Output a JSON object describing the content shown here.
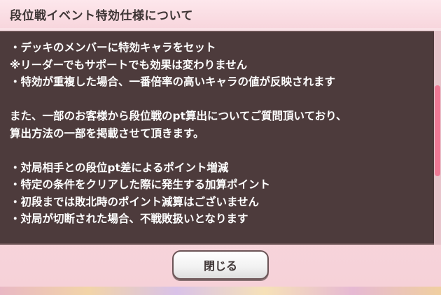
{
  "dialog": {
    "title": "段位戦イベント特効仕様について",
    "body_lines": [
      "・デッキのメンバーに特効キャラをセット",
      "※リーダーでもサポートでも効果は変わりません",
      "・特効が重複した場合、一番倍率の高いキャラの値が反映されます",
      "",
      "また、一部のお客様から段位戦のpt算出についてご質問頂いており、",
      "算出方法の一部を掲載させて頂きます。",
      "",
      "・対局相手との段位pt差によるポイント増減",
      "・特定の条件をクリアした際に発生する加算ポイント",
      "・初段までは敗北時のポイント減算はございません",
      "・対局が切断された場合、不戦敗扱いとなります"
    ],
    "close_label": "閉じる"
  },
  "colors": {
    "header_bg": "#f8d6dd",
    "panel_bg": "#4d3b3c",
    "scroll_thumb": "#f07a97"
  }
}
